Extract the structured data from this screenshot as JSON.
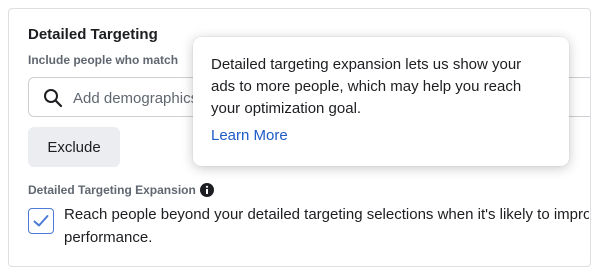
{
  "section": {
    "title": "Detailed Targeting",
    "include_label": "Include people who match"
  },
  "search": {
    "icon": "search-icon",
    "placeholder": "Add demographics, interests or behaviors"
  },
  "exclude_button": {
    "label": "Exclude"
  },
  "expansion": {
    "label": "Detailed Targeting Expansion",
    "info_icon": "info-icon",
    "checked": true,
    "text_line1": "Reach people beyond your detailed targeting selections when it's likely to improve",
    "text_line2": "performance."
  },
  "tooltip": {
    "line1": "Detailed targeting expansion lets us show your",
    "line2": "ads to more people, which may help you reach",
    "line3": "your optimization goal.",
    "link_label": "Learn More"
  },
  "colors": {
    "link": "#1d5bc6",
    "checkbox_accent": "#4e7bd6",
    "button_bg": "#ebedf0"
  }
}
